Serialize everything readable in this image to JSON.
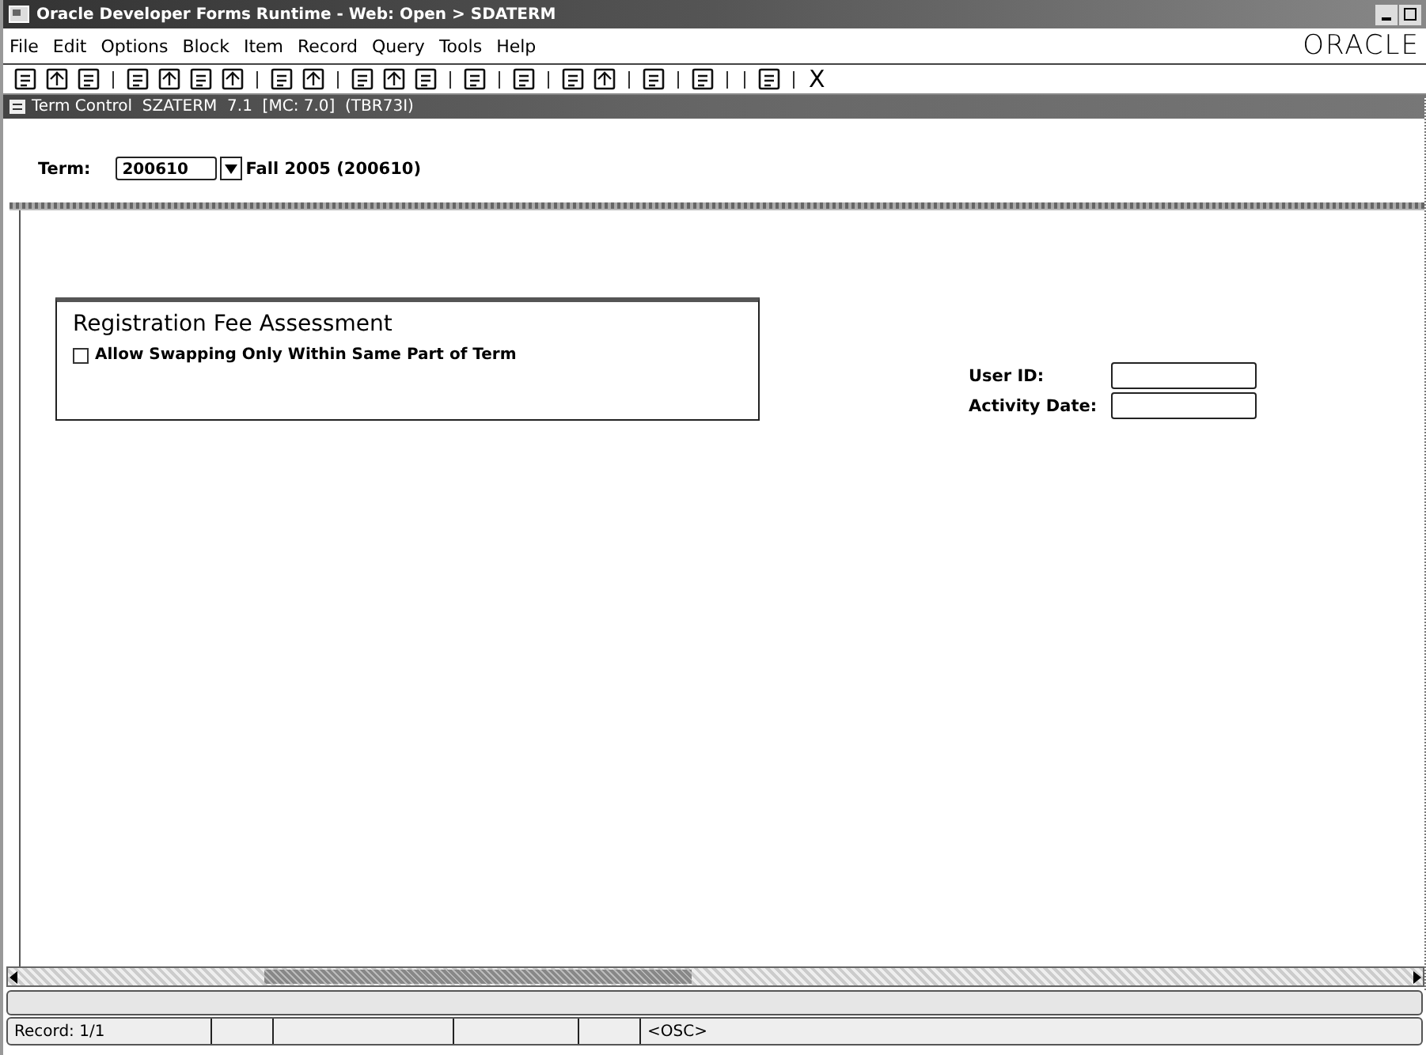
{
  "window": {
    "title": "Oracle Developer Forms Runtime - Web: Open > SDATERM"
  },
  "menu": [
    "File",
    "Edit",
    "Options",
    "Block",
    "Item",
    "Record",
    "Query",
    "Tools",
    "Help"
  ],
  "brand": "ORACLE",
  "toolbar": {
    "exit_label": "X"
  },
  "form": {
    "title": "Term Control  SZATERM  7.1  [MC: 7.0]  (TBR73I)",
    "term": {
      "label": "Term:",
      "value": "200610",
      "description": "Fall 2005 (200610)"
    },
    "section": {
      "title": "Registration Fee Assessment",
      "checkbox": {
        "label": "Allow Swapping Only Within Same Part of Term",
        "checked": false
      }
    },
    "fields": [
      {
        "label": "User ID:"
      },
      {
        "label": "Activity Date:"
      }
    ]
  },
  "status_bar": {
    "record": "Record: 1/1",
    "mode": "<OSC>"
  }
}
